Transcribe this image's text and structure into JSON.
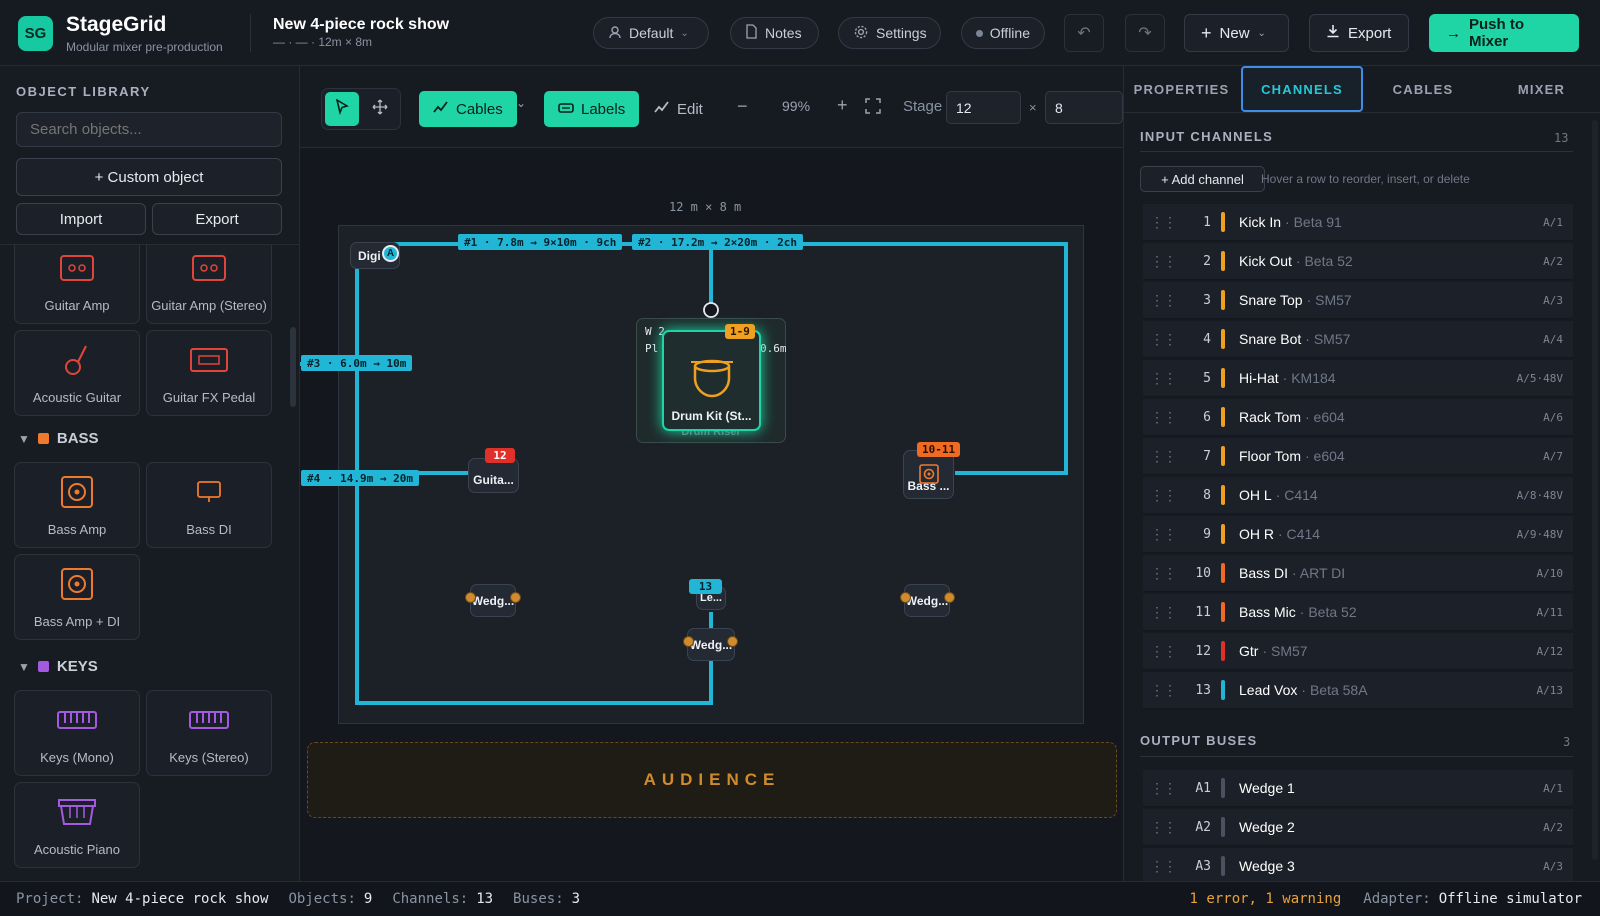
{
  "app": {
    "logo": "SG",
    "name": "StageGrid",
    "subtitle": "Modular mixer pre-production"
  },
  "project": {
    "title": "New 4-piece rock show",
    "subtitle": "— · — · 12m × 8m"
  },
  "header": {
    "profile": "Default",
    "notes": "Notes",
    "settings": "Settings",
    "status": "Offline",
    "new": "New",
    "export": "Export",
    "push": "Push to Mixer"
  },
  "library": {
    "title": "OBJECT LIBRARY",
    "search_placeholder": "Search objects...",
    "custom": "+ Custom object",
    "import": "Import",
    "export": "Export",
    "guitar_items": [
      "Guitar Amp",
      "Guitar Amp (Stereo)",
      "Acoustic Guitar",
      "Guitar FX Pedal"
    ],
    "bass_title": "BASS",
    "bass_items": [
      "Bass Amp",
      "Bass DI",
      "Bass Amp + DI"
    ],
    "keys_title": "KEYS",
    "keys_items": [
      "Keys (Mono)",
      "Keys (Stereo)",
      "Acoustic Piano"
    ],
    "colors": {
      "guitar": "#e0453a",
      "bass": "#ef7a2e",
      "keys": "#a45ae0"
    }
  },
  "toolbar": {
    "cables": "Cables",
    "labels": "Labels",
    "edit": "Edit",
    "zoom": "99%",
    "stage_label": "Stage",
    "stage_w": "12",
    "times": "×",
    "stage_h": "8"
  },
  "canvas": {
    "dimension": "12 m × 8 m",
    "audience": "AUDIENCE",
    "cables": [
      "#1 · 7.8m → 9×10m · 9ch",
      "#2 · 17.2m → 2×20m · 2ch",
      "#3 · 6.0m → 10m",
      "#4 · 14.9m → 20m"
    ],
    "objects": {
      "digi": "Digi",
      "digi_badge": "A",
      "drum": "Drum Kit (St...",
      "drum_badge": "1-9",
      "riser": "Drum Riser",
      "riser_top": "W 2",
      "riser_side": "Pl",
      "riser_right": "0.6m",
      "guitar": "Guita...",
      "guitar_badge": "12",
      "bass": "Bass ...",
      "bass_badge": "10-11",
      "wedge1": "Wedg...",
      "wedge2": "Wedg...",
      "wedge3": "Wedg...",
      "lead": "Le...",
      "lead_badge": "13"
    }
  },
  "tabs": [
    "PROPERTIES",
    "CHANNELS",
    "CABLES",
    "MIXER"
  ],
  "channels": {
    "title": "INPUT CHANNELS",
    "count": "13",
    "add": "+ Add channel",
    "hint": "Hover a row to reorder, insert, or delete",
    "rows": [
      {
        "n": "1",
        "name": "Kick In",
        "mic": "· Beta 91",
        "port": "A/1",
        "color": "#f0a020"
      },
      {
        "n": "2",
        "name": "Kick Out",
        "mic": "· Beta 52",
        "port": "A/2",
        "color": "#f0a020"
      },
      {
        "n": "3",
        "name": "Snare Top",
        "mic": "· SM57",
        "port": "A/3",
        "color": "#f0a020"
      },
      {
        "n": "4",
        "name": "Snare Bot",
        "mic": "· SM57",
        "port": "A/4",
        "color": "#f0a020"
      },
      {
        "n": "5",
        "name": "Hi-Hat",
        "mic": "· KM184",
        "port": "A/5·48V",
        "color": "#f0a020"
      },
      {
        "n": "6",
        "name": "Rack Tom",
        "mic": "· e604",
        "port": "A/6",
        "color": "#f0a020"
      },
      {
        "n": "7",
        "name": "Floor Tom",
        "mic": "· e604",
        "port": "A/7",
        "color": "#f0a020"
      },
      {
        "n": "8",
        "name": "OH L",
        "mic": "· C414",
        "port": "A/8·48V",
        "color": "#f0a020"
      },
      {
        "n": "9",
        "name": "OH R",
        "mic": "· C414",
        "port": "A/9·48V",
        "color": "#f0a020"
      },
      {
        "n": "10",
        "name": "Bass DI",
        "mic": "· ART DI",
        "port": "A/10",
        "color": "#ef6a22"
      },
      {
        "n": "11",
        "name": "Bass Mic",
        "mic": "· Beta 52",
        "port": "A/11",
        "color": "#ef6a22"
      },
      {
        "n": "12",
        "name": "Gtr",
        "mic": "· SM57",
        "port": "A/12",
        "color": "#e0302a"
      },
      {
        "n": "13",
        "name": "Lead Vox",
        "mic": "· Beta 58A",
        "port": "A/13",
        "color": "#22b6d6"
      }
    ]
  },
  "buses": {
    "title": "OUTPUT BUSES",
    "count": "3",
    "rows": [
      {
        "n": "A1",
        "name": "Wedge 1",
        "port": "A/1"
      },
      {
        "n": "A2",
        "name": "Wedge 2",
        "port": "A/2"
      },
      {
        "n": "A3",
        "name": "Wedge 3",
        "port": "A/3"
      }
    ]
  },
  "statusbar": {
    "project_label": "Project:",
    "project": "New 4-piece rock show",
    "objects_label": "Objects:",
    "objects": "9",
    "channels_label": "Channels:",
    "channels": "13",
    "buses_label": "Buses:",
    "buses": "3",
    "issues": "1 error, 1 warning",
    "adapter_label": "Adapter:",
    "adapter": "Offline simulator"
  }
}
